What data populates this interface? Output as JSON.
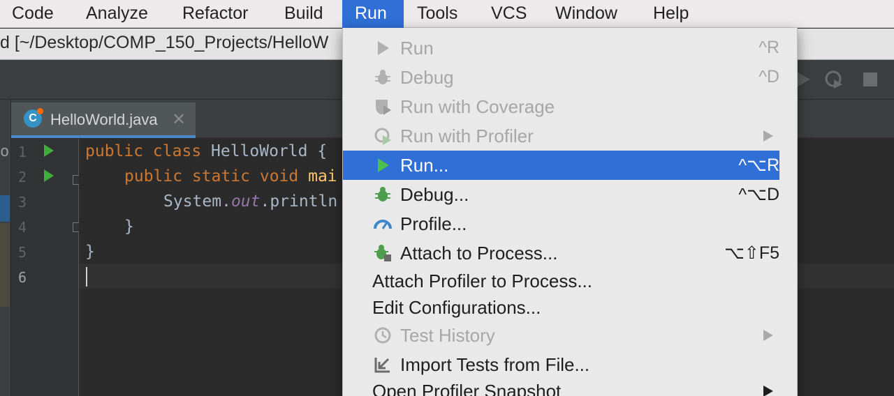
{
  "menubar": {
    "items": [
      {
        "label": "Code"
      },
      {
        "label": "Analyze"
      },
      {
        "label": "Refactor"
      },
      {
        "label": "Build"
      },
      {
        "label": "Run",
        "active": true
      },
      {
        "label": "Tools"
      },
      {
        "label": "VCS"
      },
      {
        "label": "Window"
      },
      {
        "label": "Help"
      }
    ]
  },
  "window": {
    "title": "d [~/Desktop/COMP_150_Projects/HelloW"
  },
  "editor": {
    "tab_label": "HelloWorld.java",
    "tab_icon_letter": "C",
    "tab_close": "✕",
    "line_numbers": [
      "1",
      "2",
      "3",
      "4",
      "5",
      "6"
    ],
    "lines": {
      "l1_kw": "public class ",
      "l1_rest": "HelloWorld {",
      "l2_kw": "public static void ",
      "l2_fn": "mai",
      "l3_a": "System.",
      "l3_b": "out",
      "l3_c": ".println",
      "l4": "}",
      "l5": "}"
    },
    "left_edge_char": "o"
  },
  "run_menu": {
    "items": [
      {
        "label": "Run",
        "shortcut": "^R",
        "icon": "run-icon",
        "disabled": true
      },
      {
        "label": "Debug",
        "shortcut": "^D",
        "icon": "debug-icon",
        "disabled": true
      },
      {
        "label": "Run with Coverage",
        "shortcut": "",
        "icon": "coverage-icon",
        "disabled": true
      },
      {
        "label": "Run with Profiler",
        "shortcut": "",
        "icon": "profiler-icon",
        "disabled": true,
        "submenu": true
      },
      {
        "label": "Run...",
        "shortcut": "^⌥R",
        "icon": "run-icon",
        "highlighted": true
      },
      {
        "label": "Debug...",
        "shortcut": "^⌥D",
        "icon": "debug-icon"
      },
      {
        "label": "Profile...",
        "shortcut": "",
        "icon": "gauge-icon"
      },
      {
        "label": "Attach to Process...",
        "shortcut": "⌥⇧F5",
        "icon": "attach-debugger-icon"
      },
      {
        "label": "Attach Profiler to Process...",
        "shortcut": "",
        "icon": ""
      },
      {
        "label": "Edit Configurations...",
        "shortcut": "",
        "icon": ""
      },
      {
        "label": "Test History",
        "shortcut": "",
        "icon": "clock-icon",
        "disabled": true,
        "submenu": true
      },
      {
        "label": "Import Tests from File...",
        "shortcut": "",
        "icon": "import-icon"
      },
      {
        "label": "Open Profiler Snapshot",
        "shortcut": "",
        "icon": "",
        "submenu": true
      }
    ]
  },
  "colors": {
    "highlight": "#2f6fd6",
    "run_green": "#3fae3f",
    "keyword": "#cc7832",
    "method": "#ffc66d",
    "field": "#9876aa"
  }
}
